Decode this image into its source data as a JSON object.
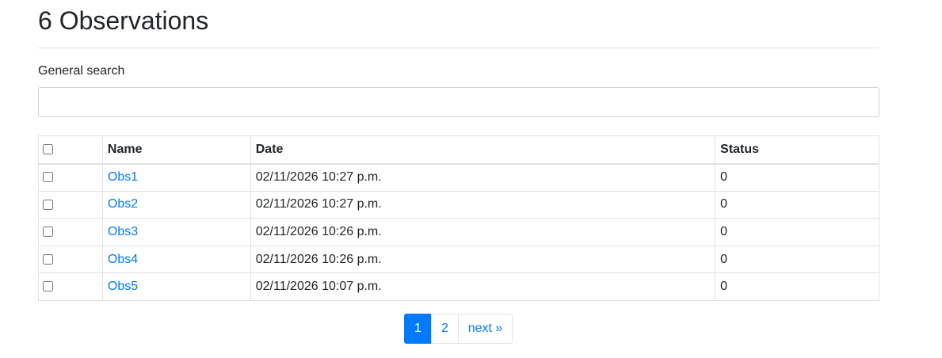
{
  "header": {
    "title": "6 Observations"
  },
  "search": {
    "label": "General search",
    "value": "",
    "placeholder": ""
  },
  "table": {
    "columns": [
      "Name",
      "Date",
      "Status"
    ],
    "rows": [
      {
        "name": "Obs1",
        "date": "02/11/2026 10:27 p.m.",
        "status": "0"
      },
      {
        "name": "Obs2",
        "date": "02/11/2026 10:27 p.m.",
        "status": "0"
      },
      {
        "name": "Obs3",
        "date": "02/11/2026 10:26 p.m.",
        "status": "0"
      },
      {
        "name": "Obs4",
        "date": "02/11/2026 10:26 p.m.",
        "status": "0"
      },
      {
        "name": "Obs5",
        "date": "02/11/2026 10:07 p.m.",
        "status": "0"
      }
    ]
  },
  "pagination": {
    "pages": [
      "1",
      "2"
    ],
    "current": "1",
    "next_label": "next »"
  },
  "colors": {
    "accent": "#007bff",
    "border": "#dee2e6",
    "text": "#212529"
  }
}
